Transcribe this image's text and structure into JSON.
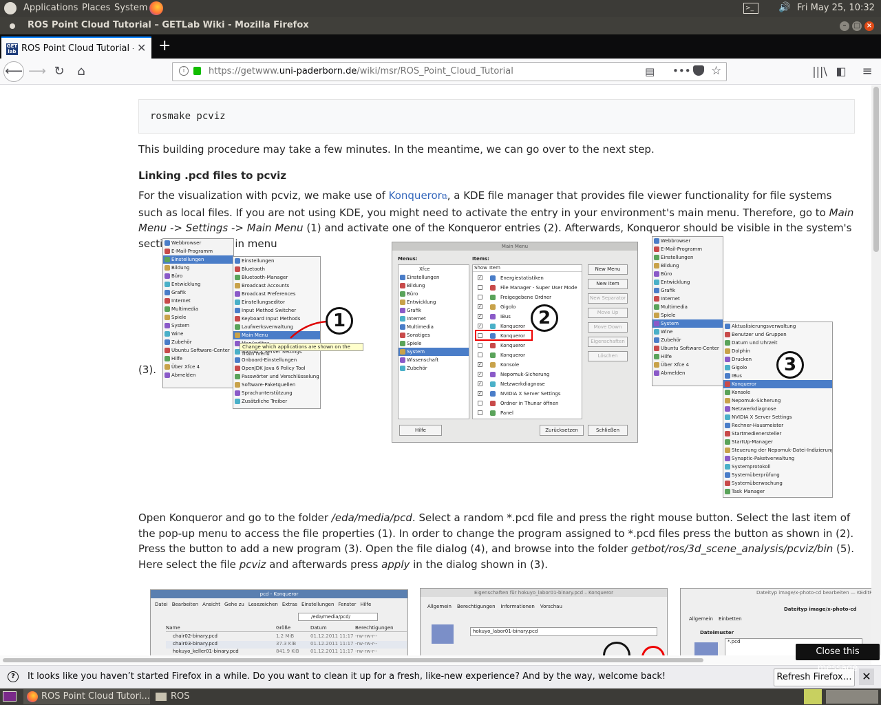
{
  "top_panel": {
    "applications": "Applications",
    "places": "Places",
    "system": "System",
    "datetime": "Fri May 25, 10:32"
  },
  "window": {
    "title": "ROS Point Cloud Tutorial – GETLab Wiki - Mozilla Firefox"
  },
  "tabs": [
    {
      "label": "ROS Point Cloud Tutorial –"
    }
  ],
  "nav": {
    "url_prefix": "https://getwww.",
    "url_domain": "uni-paderborn.de",
    "url_path": "/wiki/msr/ROS_Point_Cloud_Tutorial"
  },
  "article": {
    "code": "rosmake pcviz",
    "p_build": "This building procedure may take a few minutes. In the meantime, we can go over to the next step.",
    "heading": "Linking .pcd files to pcviz",
    "p_link_a": "For the visualization with pcviz, we make use of ",
    "konqueror_link": "Konqueror",
    "p_link_b": ", a KDE file manager that provides file viewer functionality for file systems such as local files. If you are not using KDE, you might need to activate the entry in your environment's main menu. Therefore, go to ",
    "main_menu_settings": "Main Menu -> Settings",
    "arrow": "->",
    "main_menu": "Main Menu",
    "p_link_c": " (1) and activate one of the Konqueror entries (2). Afterwards, Konqueror should be visible in the system's section of your main menu",
    "p3_label": "(3).",
    "p_open_a": "Open Konqueror and go to the folder ",
    "folder": "/eda/media/pcd",
    "p_open_b": ". Select a random *.pcd file and press the right mouse button. Select the last item of the pop-up menu to access the file properties (1). In order to change the program assigned to *.pcd files press the button as shown in (2). Press the button to add a new program (3). Open the file dialog (4), and browse into the folder ",
    "bin_path": "getbot/ros/3d_scene_analysis/pcviz/bin",
    "p_open_c": " (5). Here select the file ",
    "pcviz_file": "pcviz",
    "p_open_d": " and afterwards press ",
    "apply": "apply",
    "p_open_e": " in the dialog shown in (3)."
  },
  "fig1": {
    "left_menu": [
      "Webbrowser",
      "E-Mail-Programm",
      "Einstellungen",
      "Bildung",
      "Büro",
      "Entwicklung",
      "Grafik",
      "Internet",
      "Multimedia",
      "Spiele",
      "System",
      "Wine",
      "Zubehör",
      "Ubuntu Software-Center",
      "Hilfe",
      "Über Xfce 4",
      "Abmelden"
    ],
    "sub_menu": [
      "Einstellungen",
      "Bluetooth",
      "Bluetooth-Manager",
      "Broadcast Accounts",
      "Broadcast Preferences",
      "Einstellungseditor",
      "Input Method Switcher",
      "Keyboard Input Methods",
      "Laufwerksverwaltung",
      "Main Menu",
      "Menüeditor",
      "NVIDIA X Server Settings",
      "Onboard-Einstellungen",
      "OpenJDK Java 6 Policy Tool",
      "Passwörter und Verschlüsselung",
      "Software-Paketquellen",
      "Sprachunterstützung",
      "Zusätzliche Treiber"
    ],
    "tooltip": "Change which applications are shown on the main menu",
    "badge": "1"
  },
  "fig2": {
    "title": "Main Menu",
    "menus_label": "Menus:",
    "items_label": "Items:",
    "tree_root": "Xfce",
    "tree": [
      "Einstellungen",
      "Bildung",
      "Büro",
      "Entwicklung",
      "Grafik",
      "Internet",
      "Multimedia",
      "Sonstiges",
      "Spiele",
      "System",
      "Wissenschaft",
      "Zubehör"
    ],
    "col_show": "Show",
    "col_item": "Item",
    "items": [
      "Energiestatistiken",
      "File Manager - Super User Mode",
      "Freigegebene Ordner",
      "Gigolo",
      "IBus",
      "Konqueror",
      "Konqueror",
      "Konqueror",
      "Konqueror",
      "Konsole",
      "Nepomuk-Sicherung",
      "Netzwerkdiagnose",
      "NVIDIA X Server Settings",
      "Ordner in Thunar öffnen",
      "Panel"
    ],
    "buttons": [
      "New Menu",
      "New Item",
      "New Separator",
      "Move Up",
      "Move Down",
      "Eigenschaften",
      "Löschen"
    ],
    "help": "Hilfe",
    "reset": "Zurücksetzen",
    "close": "Schließen",
    "badge": "2"
  },
  "fig3": {
    "left_menu": [
      "Webbrowser",
      "E-Mail-Programm",
      "Einstellungen",
      "Bildung",
      "Büro",
      "Entwicklung",
      "Grafik",
      "Internet",
      "Multimedia",
      "Spiele",
      "System",
      "Wine",
      "Zubehör",
      "Ubuntu Software-Center",
      "Hilfe",
      "Über Xfce 4",
      "Abmelden"
    ],
    "sub_menu": [
      "Aktualisierungsverwaltung",
      "Benutzer und Gruppen",
      "Datum und Uhrzeit",
      "Dolphin",
      "Drucken",
      "Gigolo",
      "IBus",
      "Konqueror",
      "Konsole",
      "Nepomuk-Sicherung",
      "Netzwerkdiagnose",
      "NVIDIA X Server Settings",
      "Rechner-Hausmeister",
      "Startmedienersteller",
      "StartUp-Manager",
      "Steuerung der Nepomuk-Datei-Indizierung",
      "Synaptic-Paketverwaltung",
      "Systemprotokoll",
      "Systemüberprüfung",
      "Systemüberwachung",
      "Task Manager"
    ],
    "badge": "3"
  },
  "fig4": {
    "title": "pcd - Konqueror",
    "menu": [
      "Datei",
      "Bearbeiten",
      "Ansicht",
      "Gehe zu",
      "Lesezeichen",
      "Extras",
      "Einstellungen",
      "Fenster",
      "Hilfe"
    ],
    "path": "/eda/media/pcd/",
    "cols": [
      "Name",
      "Größe",
      "Datum",
      "Berechtigungen"
    ],
    "rows": [
      [
        "chair02-binary.pcd",
        "1.2 MiB",
        "01.12.2011 11:17",
        "-rw-rw-r--"
      ],
      [
        "chair03-binary.pcd",
        "37.3 KiB",
        "01.12.2011 11:17",
        "-rw-rw-r--"
      ],
      [
        "hokuyo_keller01-binary.pcd",
        "841.9 KiB",
        "01.12.2011 11:17",
        "-rw-rw-r--"
      ]
    ]
  },
  "fig5": {
    "title": "Eigenschaften für hokuyo_labor01-binary.pcd – Konqueror",
    "tabs": [
      "Allgemein",
      "Berechtigungen",
      "Informationen",
      "Vorschau"
    ],
    "filename": "hokuyo_labor01-binary.pcd"
  },
  "fig6": {
    "title": "Dateityp image/x-photo-cd bearbeiten — KEditFileType",
    "subtitle": "Dateityp image/x-photo-cd",
    "tabs": [
      "Allgemein",
      "Einbetten"
    ],
    "section": "Dateimuster",
    "pattern": "*.pcd"
  },
  "notification": {
    "message": "It looks like you haven’t started Firefox in a while. Do you want to clean it up for a fresh, like-new experience? And by the way, welcome back!",
    "button": "Refresh Firefox…",
    "tooltip": "Close this message"
  },
  "taskbar": {
    "firefox_task": "ROS Point Cloud Tutori...",
    "folder_task": "ROS"
  }
}
